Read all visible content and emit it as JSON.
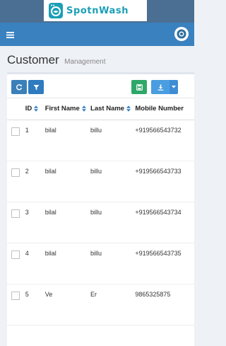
{
  "brand": {
    "name": "SpotnWash"
  },
  "page": {
    "title": "Customer",
    "subtitle": "Management"
  },
  "table": {
    "headers": {
      "id": "ID",
      "first_name": "First Name",
      "last_name": "Last Name",
      "mobile": "Mobile Number"
    },
    "rows": [
      {
        "id": "1",
        "first_name": "bilal",
        "last_name": "billu",
        "mobile": "+919566543732"
      },
      {
        "id": "2",
        "first_name": "bilal",
        "last_name": "billu",
        "mobile": "+919566543733"
      },
      {
        "id": "3",
        "first_name": "bilal",
        "last_name": "billu",
        "mobile": "+919566543734"
      },
      {
        "id": "4",
        "first_name": "bilal",
        "last_name": "billu",
        "mobile": "+919566543735"
      },
      {
        "id": "5",
        "first_name": "Ve",
        "last_name": "Er",
        "mobile": "9865325875"
      }
    ]
  },
  "icons": {
    "menu": "hamburger-icon",
    "avatar": "user-avatar-icon",
    "refresh": "refresh-icon",
    "filter": "filter-icon",
    "save": "save-icon",
    "export": "download-icon",
    "dropdown": "caret-down-icon",
    "sort": "sort-icon"
  },
  "colors": {
    "navbar": "#3a81bf",
    "logo_bar": "#4a6f93",
    "brand_text": "#1b9fb5",
    "refresh_button": "#3b80b9",
    "filter_button": "#2f7bc0",
    "save_button": "#2ea868",
    "export_button": "#4a9de0"
  }
}
